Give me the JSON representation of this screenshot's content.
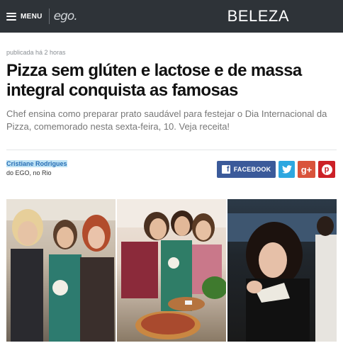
{
  "header": {
    "menu_label": "MENU",
    "logo": "ego.",
    "section": "BELEZA"
  },
  "article": {
    "published": "publicada há 2 horas",
    "title": "Pizza sem glúten e lactose e de massa integral conquista as famosas",
    "subtitle": "Chef ensina como preparar prato saudável para festejar o Dia Internacional da Pizza, comemorado nesta sexta-feira, 10. Veja receita!",
    "author": "Cristiane Rodrigues",
    "agency": "do EGO, no Rio"
  },
  "share": {
    "facebook_label": "FACEBOOK",
    "facebook_color": "#3b5a9a",
    "twitter_color": "#2ea7e0",
    "googleplus_label": "g+",
    "googleplus_color": "#d9533b",
    "pinterest_label": "p",
    "pinterest_color": "#cc2127"
  },
  "icons": [
    "hamburger-icon",
    "facebook-icon",
    "twitter-icon",
    "googleplus-icon",
    "pinterest-icon"
  ],
  "colors": {
    "topbar": "#2e3338",
    "author_highlight": "#bfe3f5"
  }
}
